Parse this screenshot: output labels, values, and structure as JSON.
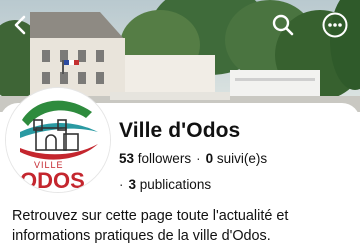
{
  "header": {
    "icons": [
      "back-arrow-icon",
      "search-icon",
      "more-options-icon"
    ]
  },
  "profile": {
    "name": "Ville d'Odos",
    "followers_count": "53",
    "followers_label": "followers",
    "following_count": "0",
    "following_label": "suivi(e)s",
    "separator": "·",
    "publications_count": "3",
    "publications_label": "publications",
    "logo_text_top": "VILLE",
    "logo_text_bottom": "ODOS",
    "description": "Retrouvez sur cette page toute l'actualité et informations pratiques de la ville d'Odos."
  },
  "colors": {
    "logo_red": "#c4262e",
    "logo_green": "#2e8b3d",
    "logo_teal": "#2a9aa2"
  }
}
